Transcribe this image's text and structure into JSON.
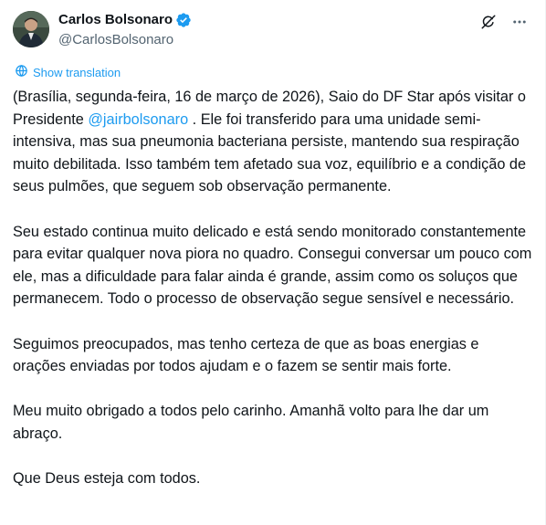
{
  "author": {
    "display_name": "Carlos Bolsonaro",
    "handle": "@CarlosBolsonaro",
    "verified": true
  },
  "actions": {
    "grok_icon": "grok-icon",
    "more_icon": "more-options-icon"
  },
  "translate": {
    "label": "Show translation",
    "icon": "translate-icon"
  },
  "body": {
    "p1_before": "(Brasília, segunda-feira, 16 de março de 2026), Saio do DF Star após visitar o Presidente ",
    "p1_mention": "@jairbolsonaro",
    "p1_after": " . Ele foi transferido para uma unidade semi-intensiva, mas sua pneumonia bacteriana persiste, mantendo sua respiração muito debilitada. Isso também tem afetado sua voz, equilíbrio e a condição de seus pulmões, que seguem sob observação permanente.",
    "p2": "Seu estado continua muito delicado e está sendo monitorado constantemente para evitar qualquer nova piora no quadro. Consegui conversar um pouco com ele, mas a dificuldade para falar ainda é grande, assim como os soluços que permanecem. Todo o processo de observação segue sensível e necessário.",
    "p3": "Seguimos preocupados, mas tenho certeza de que as boas energias e orações enviadas por todos ajudam e o fazem se sentir mais forte.",
    "p4": "Meu muito obrigado a todos pelo carinho. Amanhã volto para lhe dar um abraço.",
    "p5": "Que Deus esteja com todos."
  },
  "colors": {
    "text": "#0f1419",
    "secondary": "#536471",
    "accent": "#1d9bf0"
  }
}
